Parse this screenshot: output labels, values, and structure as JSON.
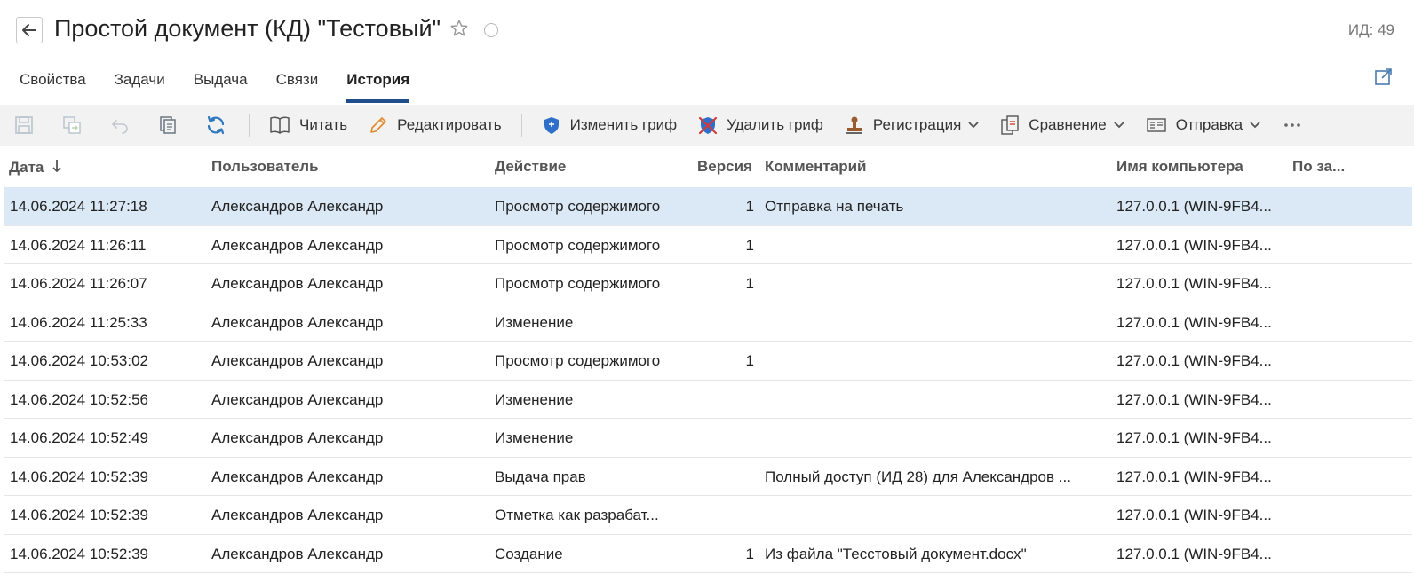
{
  "header": {
    "title": "Простой документ (КД) \"Тестовый\"",
    "id_label": "ИД: 49"
  },
  "tabs": [
    {
      "label": "Свойства",
      "active": false
    },
    {
      "label": "Задачи",
      "active": false
    },
    {
      "label": "Выдача",
      "active": false
    },
    {
      "label": "Связи",
      "active": false
    },
    {
      "label": "История",
      "active": true
    }
  ],
  "toolbar": {
    "read_label": "Читать",
    "edit_label": "Редактировать",
    "change_grif_label": "Изменить гриф",
    "delete_grif_label": "Удалить гриф",
    "registration_label": "Регистрация",
    "compare_label": "Сравнение",
    "send_label": "Отправка"
  },
  "columns": {
    "date": "Дата",
    "user": "Пользователь",
    "action": "Действие",
    "version": "Версия",
    "comment": "Комментарий",
    "host": "Имя компьютера",
    "by_request": "По за..."
  },
  "colors": {
    "accent": "#1f4e8c",
    "toolbar_bg": "#f2f2f2",
    "selected_row": "#dbe8f5"
  },
  "rows": [
    {
      "date": "14.06.2024 11:27:18",
      "user": "Александров Александр",
      "action": "Просмотр содержимого",
      "version": "1",
      "comment": "Отправка на печать",
      "host": "127.0.0.1 (WIN-9FB4..."
    },
    {
      "date": "14.06.2024 11:26:11",
      "user": "Александров Александр",
      "action": "Просмотр содержимого",
      "version": "1",
      "comment": "",
      "host": "127.0.0.1 (WIN-9FB4..."
    },
    {
      "date": "14.06.2024 11:26:07",
      "user": "Александров Александр",
      "action": "Просмотр содержимого",
      "version": "1",
      "comment": "",
      "host": "127.0.0.1 (WIN-9FB4..."
    },
    {
      "date": "14.06.2024 11:25:33",
      "user": "Александров Александр",
      "action": "Изменение",
      "version": "",
      "comment": "",
      "host": "127.0.0.1 (WIN-9FB4..."
    },
    {
      "date": "14.06.2024 10:53:02",
      "user": "Александров Александр",
      "action": "Просмотр содержимого",
      "version": "1",
      "comment": "",
      "host": "127.0.0.1 (WIN-9FB4..."
    },
    {
      "date": "14.06.2024 10:52:56",
      "user": "Александров Александр",
      "action": "Изменение",
      "version": "",
      "comment": "",
      "host": "127.0.0.1 (WIN-9FB4..."
    },
    {
      "date": "14.06.2024 10:52:49",
      "user": "Александров Александр",
      "action": "Изменение",
      "version": "",
      "comment": "",
      "host": "127.0.0.1 (WIN-9FB4..."
    },
    {
      "date": "14.06.2024 10:52:39",
      "user": "Александров Александр",
      "action": "Выдача прав",
      "version": "",
      "comment": "Полный доступ (ИД 28) для Александров ...",
      "host": "127.0.0.1 (WIN-9FB4..."
    },
    {
      "date": "14.06.2024 10:52:39",
      "user": "Александров Александр",
      "action": "Отметка как разрабат...",
      "version": "",
      "comment": "",
      "host": "127.0.0.1 (WIN-9FB4..."
    },
    {
      "date": "14.06.2024 10:52:39",
      "user": "Александров Александр",
      "action": "Создание",
      "version": "1",
      "comment": "Из файла \"Тесстовый документ.docx\"",
      "host": "127.0.0.1 (WIN-9FB4..."
    }
  ]
}
